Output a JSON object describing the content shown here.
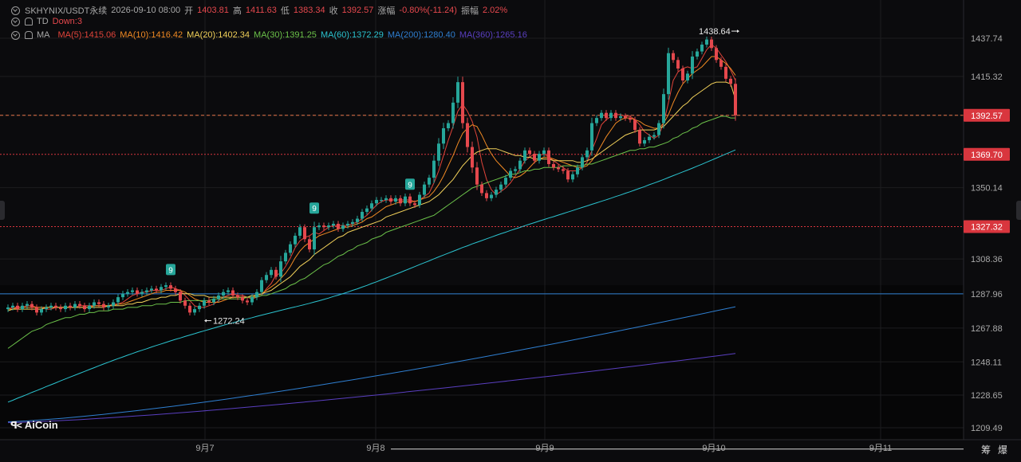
{
  "header": {
    "symbol": "SKHYNIX/USDT永续",
    "datetime": "2026-09-10 08:00",
    "open_label": "开",
    "open": "1403.81",
    "high_label": "高",
    "high": "1411.63",
    "low_label": "低",
    "low": "1383.34",
    "close_label": "收",
    "close": "1392.57",
    "change_label": "涨幅",
    "change": "-0.80%(-11.24)",
    "amplitude_label": "振幅",
    "amplitude": "2.02%",
    "td_label": "TD",
    "td_value": "Down:3",
    "ma_label": "MA"
  },
  "ma_legend": [
    {
      "text": "MA(5):1415.06",
      "color": "#e0443a"
    },
    {
      "text": "MA(10):1416.42",
      "color": "#f08a24"
    },
    {
      "text": "MA(20):1402.34",
      "color": "#f2d15a"
    },
    {
      "text": "MA(30):1391.25",
      "color": "#6cc24a"
    },
    {
      "text": "MA(60):1372.29",
      "color": "#2bc3cf"
    },
    {
      "text": "MA(200):1280.40",
      "color": "#2f7fd1"
    },
    {
      "text": "MA(360):1265.16",
      "color": "#5a3fc0"
    }
  ],
  "logo": "AiCoin",
  "corner": {
    "a": "筹",
    "b": "爆"
  },
  "colors": {
    "up": "#26a69a",
    "down": "#e5484d",
    "bg": "#0b0b0d",
    "grid": "#1c1c1f"
  },
  "chart_data": {
    "type": "candlestick",
    "y_ticks": [
      "1437.74",
      "1415.32",
      "1392.57",
      "1350.14",
      "1308.36",
      "1287.96",
      "1267.88",
      "1248.11",
      "1228.65",
      "1209.49"
    ],
    "y_range": [
      1203,
      1446
    ],
    "x_ticks": [
      "9月7",
      "9月8",
      "9月9",
      "9月10",
      "9月11"
    ],
    "price_tags": [
      {
        "value": "1392.57",
        "price": 1392.57,
        "style": "dashed-orange"
      },
      {
        "value": "1369.70",
        "price": 1369.7,
        "style": "dotted-red"
      },
      {
        "value": "1327.32",
        "price": 1327.32,
        "style": "dotted-red"
      }
    ],
    "horizontal_line": {
      "price": 1287.96,
      "color": "#2f7fd1"
    },
    "high_marker": {
      "label": "1438.64",
      "price": 1438.64
    },
    "low_marker": {
      "label": "1272.24",
      "price": 1272.24
    },
    "td_marks": [
      {
        "label": "9",
        "candle": 34
      },
      {
        "label": "9",
        "candle": 64
      },
      {
        "label": "9",
        "candle": 84
      }
    ],
    "closes": [
      1280,
      1281,
      1279,
      1281,
      1282,
      1280,
      1277,
      1279,
      1280,
      1281,
      1280,
      1279,
      1281,
      1280,
      1282,
      1281,
      1279,
      1281,
      1283,
      1282,
      1280,
      1281,
      1283,
      1286,
      1288,
      1289,
      1290,
      1288,
      1289,
      1290,
      1291,
      1290,
      1292,
      1293,
      1291,
      1289,
      1284,
      1281,
      1277,
      1279,
      1281,
      1284,
      1283,
      1285,
      1287,
      1289,
      1290,
      1287,
      1286,
      1284,
      1283,
      1286,
      1289,
      1296,
      1299,
      1302,
      1298,
      1307,
      1312,
      1317,
      1322,
      1327,
      1320,
      1314,
      1327,
      1328,
      1327,
      1328,
      1329,
      1326,
      1328,
      1329,
      1330,
      1332,
      1336,
      1338,
      1341,
      1343,
      1343,
      1344,
      1342,
      1344,
      1341,
      1345,
      1341,
      1340,
      1346,
      1352,
      1356,
      1366,
      1376,
      1385,
      1388,
      1400,
      1412,
      1388,
      1374,
      1362,
      1352,
      1347,
      1344,
      1346,
      1349,
      1352,
      1356,
      1360,
      1361,
      1366,
      1372,
      1370,
      1366,
      1370,
      1372,
      1364,
      1362,
      1361,
      1360,
      1355,
      1358,
      1362,
      1368,
      1372,
      1388,
      1391,
      1394,
      1391,
      1394,
      1391,
      1392,
      1391,
      1390,
      1384,
      1376,
      1378,
      1380,
      1381,
      1388,
      1405,
      1429,
      1425,
      1420,
      1413,
      1417,
      1427,
      1430,
      1434,
      1437,
      1432,
      1425,
      1421,
      1414,
      1411,
      1392.57
    ],
    "ma": [
      {
        "name": "MA(5)",
        "color": "#e0443a",
        "values": [
          1279,
          1280,
          1280,
          1280,
          1281,
          1281,
          1280,
          1280,
          1279,
          1279,
          1280,
          1280,
          1280,
          1280,
          1280,
          1281,
          1281,
          1281,
          1281,
          1281,
          1281,
          1281,
          1282,
          1282,
          1283,
          1285,
          1287,
          1288,
          1289,
          1289,
          1290,
          1290,
          1290,
          1291,
          1292,
          1291,
          1290,
          1287,
          1284,
          1281,
          1280,
          1280,
          1281,
          1282,
          1284,
          1286,
          1287,
          1288,
          1287,
          1287,
          1286,
          1285,
          1286,
          1287,
          1291,
          1294,
          1299,
          1300,
          1304,
          1309,
          1315,
          1319,
          1321,
          1322,
          1324,
          1323,
          1325,
          1327,
          1328,
          1328,
          1328,
          1328,
          1329,
          1330,
          1332,
          1334,
          1337,
          1340,
          1342,
          1343,
          1343,
          1343,
          1343,
          1343,
          1343,
          1342,
          1343,
          1345,
          1347,
          1353,
          1360,
          1369,
          1378,
          1386,
          1395,
          1399,
          1395,
          1389,
          1380,
          1365,
          1355,
          1349,
          1346,
          1348,
          1350,
          1353,
          1357,
          1361,
          1366,
          1368,
          1370,
          1369,
          1370,
          1368,
          1366,
          1364,
          1362,
          1360,
          1360,
          1360,
          1362,
          1365,
          1372,
          1379,
          1387,
          1390,
          1392,
          1393,
          1393,
          1392,
          1392,
          1390,
          1387,
          1383,
          1381,
          1379,
          1381,
          1388,
          1400,
          1413,
          1418,
          1420,
          1421,
          1420,
          1421,
          1426,
          1431,
          1434,
          1432,
          1428,
          1424,
          1419,
          1413
        ]
      },
      {
        "name": "MA(10)",
        "color": "#f08a24",
        "values": [
          1279,
          1279,
          1280,
          1280,
          1280,
          1280,
          1280,
          1280,
          1280,
          1280,
          1280,
          1280,
          1280,
          1280,
          1280,
          1280,
          1280,
          1280,
          1281,
          1281,
          1281,
          1281,
          1281,
          1282,
          1282,
          1283,
          1284,
          1285,
          1286,
          1287,
          1288,
          1289,
          1289,
          1290,
          1290,
          1290,
          1290,
          1289,
          1287,
          1285,
          1284,
          1283,
          1283,
          1283,
          1283,
          1284,
          1285,
          1286,
          1286,
          1286,
          1286,
          1286,
          1287,
          1288,
          1290,
          1292,
          1294,
          1297,
          1300,
          1304,
          1309,
          1313,
          1316,
          1318,
          1320,
          1322,
          1323,
          1324,
          1325,
          1326,
          1327,
          1327,
          1328,
          1329,
          1330,
          1332,
          1333,
          1335,
          1337,
          1339,
          1340,
          1341,
          1342,
          1342,
          1342,
          1342,
          1343,
          1344,
          1345,
          1348,
          1352,
          1357,
          1363,
          1369,
          1376,
          1382,
          1385,
          1387,
          1386,
          1381,
          1375,
          1370,
          1366,
          1363,
          1360,
          1357,
          1356,
          1357,
          1359,
          1362,
          1365,
          1367,
          1368,
          1368,
          1367,
          1366,
          1365,
          1364,
          1363,
          1362,
          1362,
          1363,
          1366,
          1370,
          1375,
          1380,
          1384,
          1388,
          1390,
          1391,
          1391,
          1390,
          1389,
          1387,
          1386,
          1385,
          1385,
          1388,
          1393,
          1400,
          1406,
          1411,
          1414,
          1417,
          1419,
          1421,
          1424,
          1427,
          1427,
          1425,
          1423,
          1420,
          1416
        ]
      },
      {
        "name": "MA(20)",
        "color": "#f2d15a",
        "values": [
          1278,
          1279,
          1279,
          1279,
          1279,
          1279,
          1279,
          1279,
          1280,
          1280,
          1280,
          1280,
          1280,
          1280,
          1280,
          1280,
          1280,
          1280,
          1280,
          1280,
          1280,
          1281,
          1281,
          1281,
          1281,
          1282,
          1282,
          1283,
          1283,
          1284,
          1285,
          1285,
          1286,
          1286,
          1287,
          1287,
          1288,
          1288,
          1288,
          1287,
          1287,
          1287,
          1286,
          1286,
          1286,
          1286,
          1286,
          1286,
          1286,
          1286,
          1286,
          1287,
          1287,
          1288,
          1289,
          1290,
          1292,
          1294,
          1296,
          1298,
          1301,
          1304,
          1306,
          1308,
          1311,
          1313,
          1315,
          1317,
          1319,
          1321,
          1322,
          1324,
          1325,
          1326,
          1327,
          1328,
          1329,
          1330,
          1331,
          1333,
          1334,
          1335,
          1336,
          1337,
          1338,
          1339,
          1340,
          1341,
          1342,
          1344,
          1346,
          1349,
          1352,
          1355,
          1359,
          1363,
          1366,
          1369,
          1371,
          1372,
          1373,
          1373,
          1373,
          1372,
          1371,
          1370,
          1369,
          1369,
          1368,
          1368,
          1367,
          1367,
          1367,
          1367,
          1366,
          1366,
          1366,
          1366,
          1366,
          1365,
          1365,
          1366,
          1367,
          1369,
          1371,
          1373,
          1375,
          1377,
          1379,
          1381,
          1382,
          1383,
          1384,
          1384,
          1384,
          1384,
          1385,
          1386,
          1389,
          1392,
          1395,
          1398,
          1400,
          1403,
          1405,
          1407,
          1409,
          1411,
          1412,
          1412,
          1412,
          1411,
          1402
        ]
      },
      {
        "name": "MA(30)",
        "color": "#6cc24a",
        "values": [
          1256,
          1258,
          1260,
          1262,
          1264,
          1266,
          1267,
          1268,
          1270,
          1271,
          1272,
          1273,
          1274,
          1274,
          1275,
          1276,
          1276,
          1277,
          1277,
          1278,
          1278,
          1278,
          1279,
          1279,
          1279,
          1280,
          1280,
          1280,
          1281,
          1281,
          1281,
          1282,
          1282,
          1282,
          1283,
          1283,
          1283,
          1284,
          1284,
          1284,
          1284,
          1284,
          1284,
          1285,
          1285,
          1285,
          1285,
          1285,
          1285,
          1285,
          1286,
          1286,
          1286,
          1287,
          1287,
          1288,
          1289,
          1290,
          1291,
          1293,
          1294,
          1296,
          1297,
          1299,
          1301,
          1303,
          1305,
          1306,
          1308,
          1310,
          1311,
          1313,
          1314,
          1316,
          1317,
          1318,
          1320,
          1321,
          1322,
          1324,
          1325,
          1326,
          1327,
          1328,
          1329,
          1330,
          1331,
          1332,
          1333,
          1334,
          1336,
          1338,
          1340,
          1342,
          1344,
          1346,
          1348,
          1350,
          1351,
          1352,
          1353,
          1354,
          1355,
          1356,
          1357,
          1358,
          1358,
          1359,
          1360,
          1360,
          1361,
          1361,
          1362,
          1362,
          1362,
          1362,
          1363,
          1363,
          1363,
          1363,
          1363,
          1364,
          1364,
          1365,
          1366,
          1367,
          1368,
          1369,
          1370,
          1371,
          1372,
          1372,
          1373,
          1373,
          1374,
          1374,
          1375,
          1376,
          1377,
          1379,
          1380,
          1382,
          1383,
          1385,
          1386,
          1388,
          1389,
          1390,
          1391,
          1392,
          1392,
          1391,
          1391
        ]
      },
      {
        "name": "MA(60)",
        "color": "#2bc3cf",
        "values": [
          1224.5,
          1225.6,
          1226.8,
          1227.9,
          1229.0,
          1230.2,
          1231.3,
          1232.4,
          1233.6,
          1234.7,
          1235.8,
          1237.0,
          1238.1,
          1239.2,
          1240.3,
          1241.4,
          1242.5,
          1243.6,
          1244.7,
          1245.8,
          1246.9,
          1247.9,
          1249.0,
          1250.0,
          1251.0,
          1252.0,
          1253.0,
          1254.0,
          1254.9,
          1255.8,
          1256.8,
          1257.7,
          1258.6,
          1259.5,
          1260.4,
          1261.3,
          1262.1,
          1263.0,
          1263.8,
          1264.6,
          1265.5,
          1266.3,
          1267.1,
          1267.9,
          1268.7,
          1269.5,
          1270.3,
          1271.0,
          1271.8,
          1272.6,
          1273.3,
          1274.0,
          1274.8,
          1275.5,
          1276.2,
          1276.9,
          1277.6,
          1278.3,
          1279.0,
          1279.7,
          1280.3,
          1281.0,
          1281.7,
          1282.4,
          1283.2,
          1283.9,
          1284.7,
          1285.5,
          1286.4,
          1287.2,
          1288.1,
          1289.0,
          1290.0,
          1290.9,
          1291.9,
          1292.9,
          1294.0,
          1295.0,
          1296.1,
          1297.2,
          1298.3,
          1299.4,
          1300.5,
          1301.7,
          1302.8,
          1303.9,
          1305.1,
          1306.2,
          1307.3,
          1308.5,
          1309.6,
          1310.7,
          1311.8,
          1312.9,
          1314.0,
          1315.1,
          1316.1,
          1317.2,
          1318.2,
          1319.2,
          1320.2,
          1321.2,
          1322.2,
          1323.2,
          1324.1,
          1325.1,
          1326.0,
          1326.9,
          1327.9,
          1328.8,
          1329.7,
          1330.6,
          1331.5,
          1332.4,
          1333.2,
          1334.1,
          1335.0,
          1335.9,
          1336.8,
          1337.7,
          1338.6,
          1339.5,
          1340.4,
          1341.3,
          1342.2,
          1343.1,
          1344.0,
          1345.0,
          1345.9,
          1346.9,
          1347.8,
          1348.8,
          1349.8,
          1350.8,
          1351.9,
          1352.9,
          1353.9,
          1355.0,
          1356.1,
          1357.2,
          1358.3,
          1359.4,
          1360.5,
          1361.6,
          1362.8,
          1363.9,
          1365.1,
          1366.3,
          1367.5,
          1368.7,
          1369.9,
          1371.1,
          1372.29
        ]
      }
    ],
    "far_ma": [
      {
        "name": "MA(200)",
        "color": "#2f7fd1",
        "start": 1213.0,
        "end": 1280.4
      },
      {
        "name": "MA(360)",
        "color": "#5a3fc0",
        "start": 1212.5,
        "end": 1253.0
      },
      {
        "name": "trend",
        "color": "#d7d7d7",
        "start": 1197.0,
        "end": 1236.0
      }
    ]
  }
}
